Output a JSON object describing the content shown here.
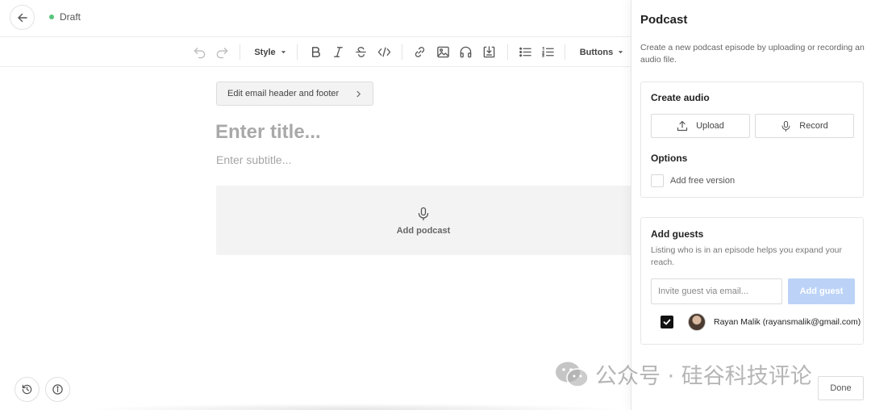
{
  "topbar": {
    "status": "Draft",
    "status_color": "#58c47b"
  },
  "toolbar": {
    "style_label": "Style",
    "buttons_label": "Buttons"
  },
  "editor": {
    "edit_header_footer": "Edit email header and footer",
    "title_placeholder": "Enter title...",
    "subtitle_placeholder": "Enter subtitle...",
    "add_podcast": "Add podcast"
  },
  "panel": {
    "title": "Podcast",
    "description": "Create a new podcast episode by uploading or recording an audio file.",
    "create_audio": {
      "heading": "Create audio",
      "upload_label": "Upload",
      "record_label": "Record"
    },
    "options": {
      "heading": "Options",
      "free_version_label": "Add free version",
      "free_version_checked": false
    },
    "guests": {
      "heading": "Add guests",
      "description": "Listing who is in an episode helps you expand your reach.",
      "invite_placeholder": "Invite guest via email...",
      "add_guest_label": "Add guest",
      "list": [
        {
          "name": "Rayan Malik (rayansmalik@gmail.com)",
          "checked": true
        }
      ]
    },
    "done_label": "Done"
  },
  "watermark": "公众号 · 硅谷科技评论",
  "colors": {
    "accent_disabled": "#bcd3f7",
    "status_green": "#58c47b"
  }
}
